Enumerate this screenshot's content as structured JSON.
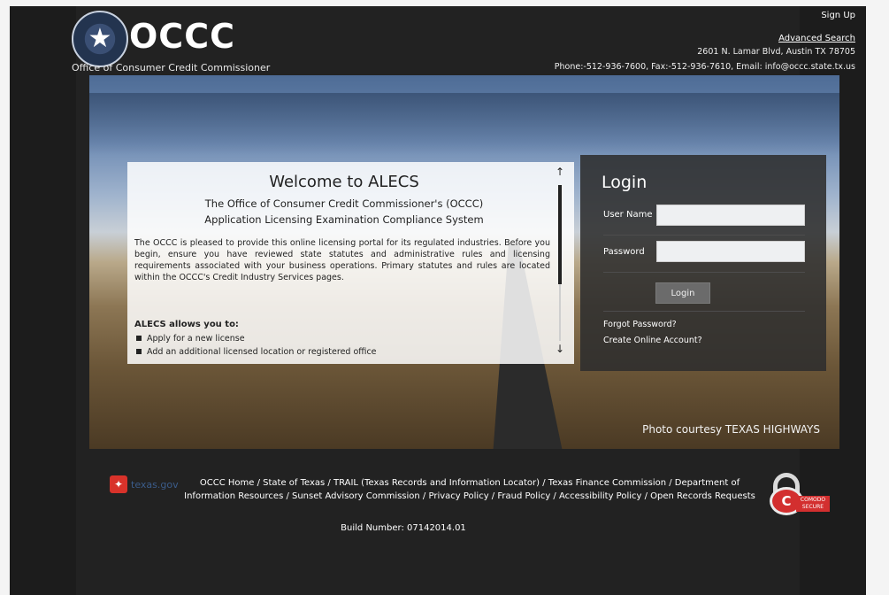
{
  "header": {
    "logo_text": "OCCC",
    "office_name": "Office of Consumer Credit Commissioner",
    "sign_up": "Sign Up",
    "advanced_search": "Advanced Search",
    "address": "2601 N. Lamar Blvd, Austin TX 78705",
    "contact": "Phone:-512-936-7600, Fax:-512-936-7610, Email: info@occc.state.tx.us"
  },
  "welcome": {
    "title": "Welcome to ALECS",
    "subtitle_1": "The Office of Consumer Credit Commissioner's (OCCC)",
    "subtitle_2": "Application Licensing Examination Compliance System",
    "intro": "The OCCC is pleased to provide this online licensing portal for its regulated industries. Before you begin, ensure you have reviewed state statutes and administrative rules and licensing requirements associated with your business operations. Primary statutes and rules are located within the OCCC's Credit Industry Services pages.",
    "allows_heading": "ALECS allows you to:",
    "allows_items": [
      "Apply for a new license",
      "Add an additional licensed location or registered office"
    ]
  },
  "login": {
    "title": "Login",
    "username_label": "User Name",
    "username_value": "",
    "password_label": "Password",
    "password_value": "",
    "login_button": "Login",
    "forgot_password": "Forgot Password?",
    "create_account": "Create Online Account?"
  },
  "hero": {
    "photo_credit": "Photo courtesy TEXAS HIGHWAYS"
  },
  "footer": {
    "texas_gov": "texas.gov",
    "links_line_1": "OCCC Home  / State of Texas  / TRAIL (Texas Records and Information Locator)  / Texas Finance Commission  / Department of",
    "links_line_2": "Information Resources  / Sunset Advisory Commission  / Privacy Policy  / Fraud Policy  / Accessibility Policy  / Open Records Requests",
    "build_number": "Build Number: 07142014.01",
    "comodo_badge": "COMODO SECURE"
  },
  "icons": {
    "seal": "state-seal-icon",
    "scroll_up": "arrow-up-icon",
    "scroll_down": "arrow-down-icon",
    "texas_gov_logo": "texas-map-icon",
    "comodo": "padlock-icon"
  },
  "colors": {
    "page_bg": "#1c1c1c",
    "login_panel": "#2d2d2d",
    "texas_red": "#d8322a",
    "comodo_red": "#d32f2f"
  }
}
